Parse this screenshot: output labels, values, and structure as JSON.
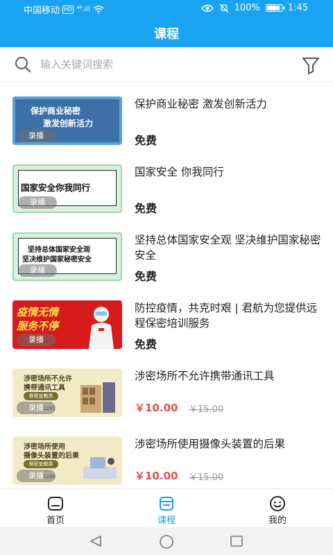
{
  "status_bar": {
    "carrier": "中国移动",
    "hd": "HD",
    "signal": "⁴⁶.ıll",
    "battery_percent": "100%",
    "time": "1:45",
    "battery_level": 1.0
  },
  "header": {
    "title": "课程"
  },
  "search": {
    "placeholder": "输入关键词搜索",
    "value": ""
  },
  "courses": [
    {
      "title": "保护商业秘密  激发创新活力",
      "tag": "录播",
      "price_label": "免费",
      "thumb_lines": [
        "保护商业秘密",
        "激发创新活力"
      ]
    },
    {
      "title": "国家安全 你我同行",
      "tag": "录播",
      "price_label": "免费",
      "thumb_lines": [
        "国家安全你我同行"
      ]
    },
    {
      "title": "坚持总体国家安全观 坚决维护国家秘密安全",
      "tag": "录播",
      "price_label": "免费",
      "thumb_lines": [
        "坚持总体国家安全观",
        "坚决维护国家秘密安全"
      ]
    },
    {
      "title": "防控疫情，共克时艰 | 君航为您提供远程保密培训服务",
      "tag": "录播",
      "price_label": "免费",
      "thumb_lines": [
        "疫情无情",
        "服务不停"
      ]
    },
    {
      "title": "涉密场所不允许携带通讯工具",
      "tag": "录播",
      "price": "￥10.00",
      "price_old": "￥15.00",
      "thumb_lines": [
        "涉密场所不允许",
        "携带通讯工具"
      ],
      "thumb_button": "保密宣教类",
      "thumb_count": "1291"
    },
    {
      "title": "涉密场所使用摄像头装置的后果",
      "tag": "录播",
      "price": "￥10.00",
      "price_old": "￥15.00",
      "thumb_lines": [
        "涉密场所使用",
        "摄像头装置的后果"
      ],
      "thumb_button": "保密宣教类",
      "thumb_count": "1290"
    }
  ],
  "bottom_nav": [
    {
      "label": "首页",
      "icon": "home-icon",
      "active": false
    },
    {
      "label": "课程",
      "icon": "course-icon",
      "active": true
    },
    {
      "label": "我的",
      "icon": "smiley-icon",
      "active": false
    }
  ],
  "colors": {
    "primary": "#1aa3f0",
    "price": "#e94f4f",
    "active_nav": "#1a9fe8"
  }
}
